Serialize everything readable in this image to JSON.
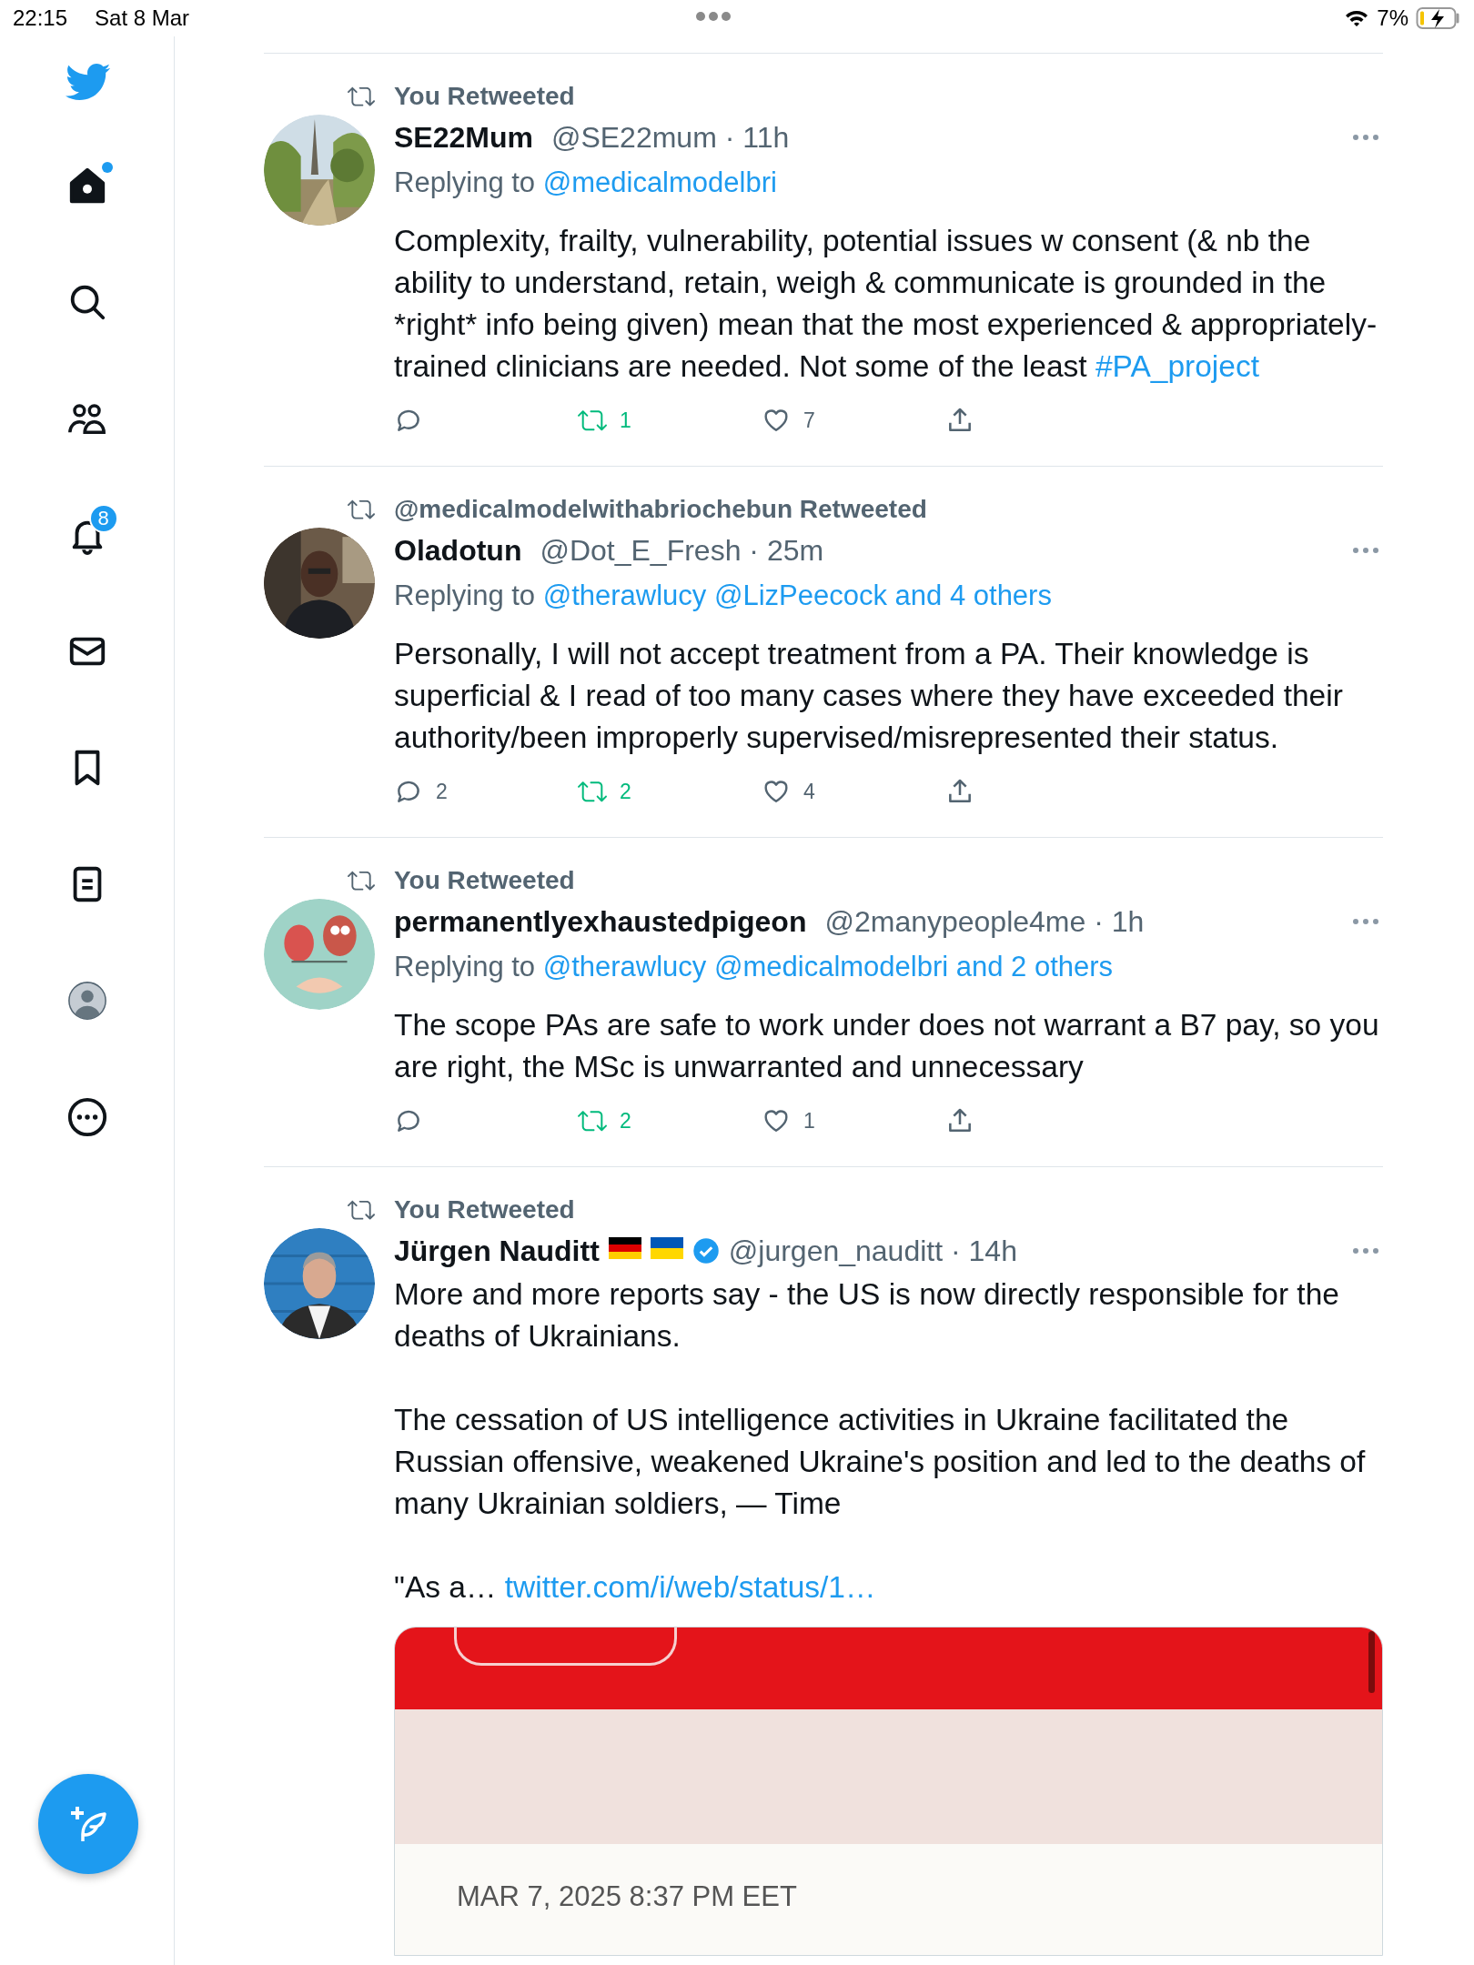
{
  "status_bar": {
    "time": "22:15",
    "date": "Sat 8 Mar",
    "battery": "7%"
  },
  "sidebar": {
    "items": [
      {
        "kind": "home",
        "selected": true,
        "unread": true
      },
      {
        "kind": "search",
        "selected": false
      },
      {
        "kind": "communities",
        "selected": false
      },
      {
        "kind": "notifications",
        "selected": false,
        "badge": "8"
      },
      {
        "kind": "messages",
        "selected": false
      },
      {
        "kind": "bookmarks",
        "selected": false
      },
      {
        "kind": "lists",
        "selected": false
      },
      {
        "kind": "profile",
        "selected": false
      },
      {
        "kind": "more",
        "selected": false
      }
    ]
  },
  "timeline": {
    "tweets": [
      {
        "social_context": "You Retweeted",
        "author": "SE22Mum",
        "meta": "@SE22mum · 11h",
        "replying_to": {
          "label": "Replying to",
          "mentions": "@medicalmodelbri"
        },
        "body": [
          [
            {
              "text": "Complexity, frailty, vulnerability, potential issues w consent (& nb the ability to understand, retain, weigh & communicate is grounded in the *right* info being given) mean that the most experienced & appropriately-trained clinicians are needed. Not some of the least "
            },
            {
              "text": "#PA_project",
              "kind": "link"
            }
          ]
        ],
        "actions": [
          {
            "kind": "reply",
            "active": false
          },
          {
            "kind": "retweet",
            "count": "1",
            "active": true
          },
          {
            "kind": "like",
            "count": "7",
            "active": false
          },
          {
            "kind": "share",
            "active": false
          }
        ]
      },
      {
        "social_context": "@medicalmodelwithabriochebun Retweeted",
        "author": "Oladotun",
        "meta": "@Dot_E_Fresh · 25m",
        "replying_to": {
          "label": "Replying to",
          "mentions": "@therawlucy @LizPeecock and 4 others"
        },
        "body": [
          [
            {
              "text": "Personally, I will not accept treatment from a PA. Their knowledge is superficial & I read of too many cases where they have exceeded their authority/been improperly supervised/misrepresented their status."
            }
          ]
        ],
        "actions": [
          {
            "kind": "reply",
            "count": "2",
            "active": false
          },
          {
            "kind": "retweet",
            "count": "2",
            "active": true
          },
          {
            "kind": "like",
            "count": "4",
            "active": false
          },
          {
            "kind": "share",
            "active": false
          }
        ]
      },
      {
        "social_context": "You Retweeted",
        "author": "permanentlyexhaustedpigeon",
        "meta": "@2manypeople4me · 1h",
        "replying_to": {
          "label": "Replying to",
          "mentions": "@therawlucy @medicalmodelbri and 2 others"
        },
        "body": [
          [
            {
              "text": "The scope PAs are safe to work under does not warrant a B7 pay, so you are right, the MSc is unwarranted and unnecessary"
            }
          ]
        ],
        "actions": [
          {
            "kind": "reply",
            "active": false
          },
          {
            "kind": "retweet",
            "count": "2",
            "active": true
          },
          {
            "kind": "like",
            "count": "1",
            "active": false
          },
          {
            "kind": "share",
            "active": false
          }
        ]
      },
      {
        "social_context": "You Retweeted",
        "author": "Jürgen Nauditt",
        "flags": [
          {
            "kind": "germany"
          },
          {
            "kind": "ukraine"
          }
        ],
        "verified": true,
        "meta": "@jurgen_nauditt · 14h",
        "body": [
          [
            {
              "text": "More and more reports say - the US is now directly responsible for the deaths of Ukrainians."
            }
          ],
          [
            {
              "text": "The cessation of US intelligence activities in Ukraine facilitated the Russian offensive, weakened Ukraine's position and led to the deaths of many Ukrainian soldiers, — Time"
            }
          ],
          [
            {
              "text": "\"As a… "
            },
            {
              "text": "twitter.com/i/web/status/1…",
              "kind": "link"
            }
          ]
        ],
        "media": {
          "date": "MAR 7, 2025 8:37 PM EET"
        }
      }
    ]
  }
}
